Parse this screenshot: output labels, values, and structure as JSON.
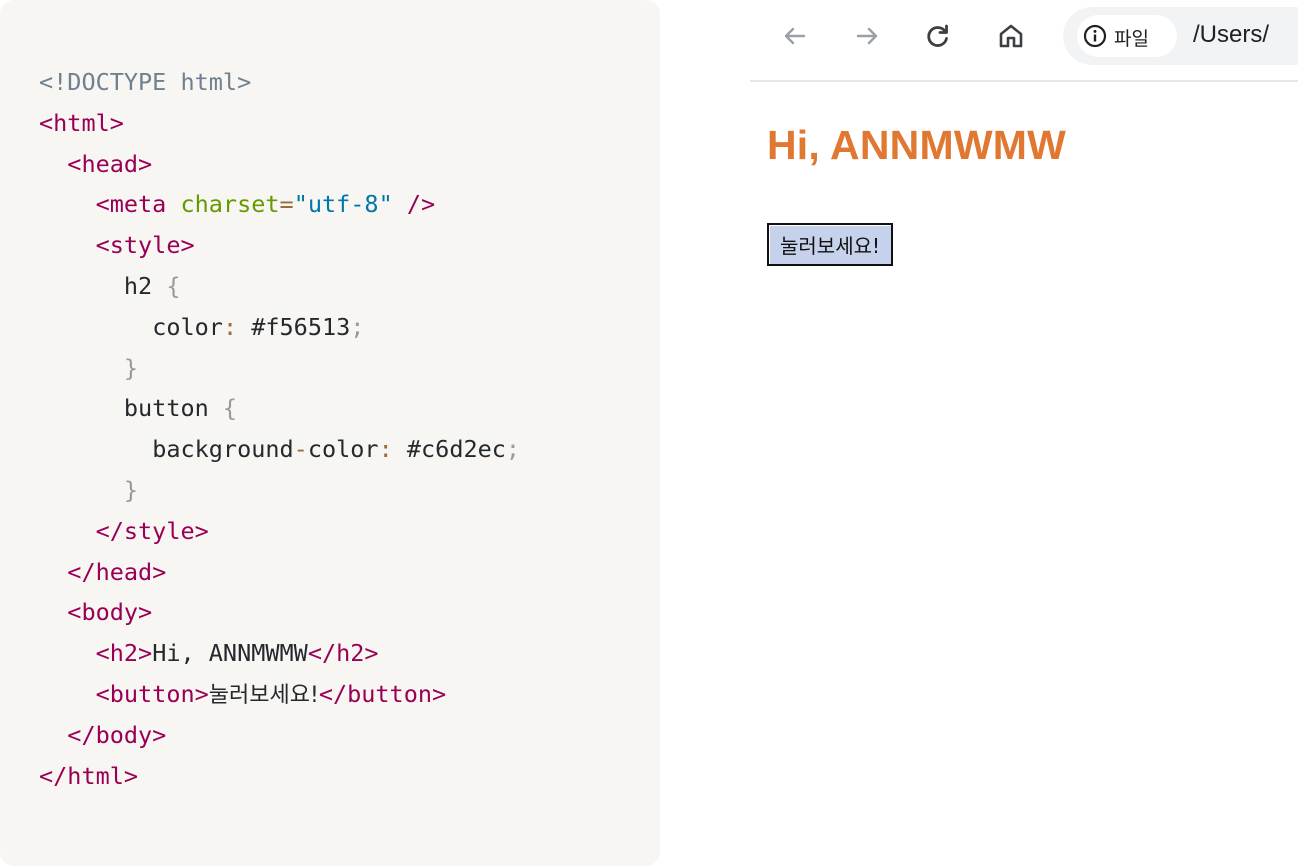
{
  "code": {
    "lines": [
      [
        {
          "t": "doc",
          "v": "<!DOCTYPE html>"
        }
      ],
      [
        {
          "t": "tag",
          "v": "<html>"
        }
      ],
      [
        {
          "t": "txt",
          "v": "  "
        },
        {
          "t": "tag",
          "v": "<head>"
        }
      ],
      [
        {
          "t": "txt",
          "v": "    "
        },
        {
          "t": "tag",
          "v": "<meta "
        },
        {
          "t": "attr",
          "v": "charset"
        },
        {
          "t": "op",
          "v": "="
        },
        {
          "t": "str",
          "v": "\"utf-8\""
        },
        {
          "t": "tag",
          "v": " />"
        }
      ],
      [
        {
          "t": "txt",
          "v": "    "
        },
        {
          "t": "tag",
          "v": "<style>"
        }
      ],
      [
        {
          "t": "txt",
          "v": "      "
        },
        {
          "t": "sel",
          "v": "h2"
        },
        {
          "t": "punc",
          "v": " {"
        }
      ],
      [
        {
          "t": "txt",
          "v": "        "
        },
        {
          "t": "txt",
          "v": "color"
        },
        {
          "t": "op",
          "v": ":"
        },
        {
          "t": "txt",
          "v": " #f56513"
        },
        {
          "t": "punc",
          "v": ";"
        }
      ],
      [
        {
          "t": "txt",
          "v": "      "
        },
        {
          "t": "punc",
          "v": "}"
        }
      ],
      [
        {
          "t": "txt",
          "v": "      "
        },
        {
          "t": "sel",
          "v": "button"
        },
        {
          "t": "punc",
          "v": " {"
        }
      ],
      [
        {
          "t": "txt",
          "v": "        "
        },
        {
          "t": "txt",
          "v": "background"
        },
        {
          "t": "op",
          "v": "-"
        },
        {
          "t": "txt",
          "v": "color"
        },
        {
          "t": "op",
          "v": ":"
        },
        {
          "t": "txt",
          "v": " #c6d2ec"
        },
        {
          "t": "punc",
          "v": ";"
        }
      ],
      [
        {
          "t": "txt",
          "v": "      "
        },
        {
          "t": "punc",
          "v": "}"
        }
      ],
      [
        {
          "t": "txt",
          "v": "    "
        },
        {
          "t": "tag",
          "v": "</style>"
        }
      ],
      [
        {
          "t": "txt",
          "v": "  "
        },
        {
          "t": "tag",
          "v": "</head>"
        }
      ],
      [
        {
          "t": "txt",
          "v": "  "
        },
        {
          "t": "tag",
          "v": "<body>"
        }
      ],
      [
        {
          "t": "txt",
          "v": "    "
        },
        {
          "t": "tag",
          "v": "<h2>"
        },
        {
          "t": "txt",
          "v": "Hi, ANNMWMW"
        },
        {
          "t": "tag",
          "v": "</h2>"
        }
      ],
      [
        {
          "t": "txt",
          "v": "    "
        },
        {
          "t": "tag",
          "v": "<button>"
        },
        {
          "t": "kor",
          "v": "눌러보세요!"
        },
        {
          "t": "tag",
          "v": "</button>"
        }
      ],
      [
        {
          "t": "txt",
          "v": "  "
        },
        {
          "t": "tag",
          "v": "</body>"
        }
      ],
      [
        {
          "t": "tag",
          "v": "</html>"
        }
      ]
    ]
  },
  "browser": {
    "nav": {
      "back_icon": "arrow-left-icon",
      "forward_icon": "arrow-right-icon",
      "reload_icon": "reload-icon",
      "home_icon": "home-icon"
    },
    "address": {
      "chip_icon": "info-icon",
      "chip_label": "파일",
      "url": "/Users/"
    },
    "page": {
      "heading": "Hi, ANNMWMW",
      "heading_color": "#e07832",
      "button_label": "눌러보세요!",
      "button_color": "#c6d2ec"
    }
  }
}
